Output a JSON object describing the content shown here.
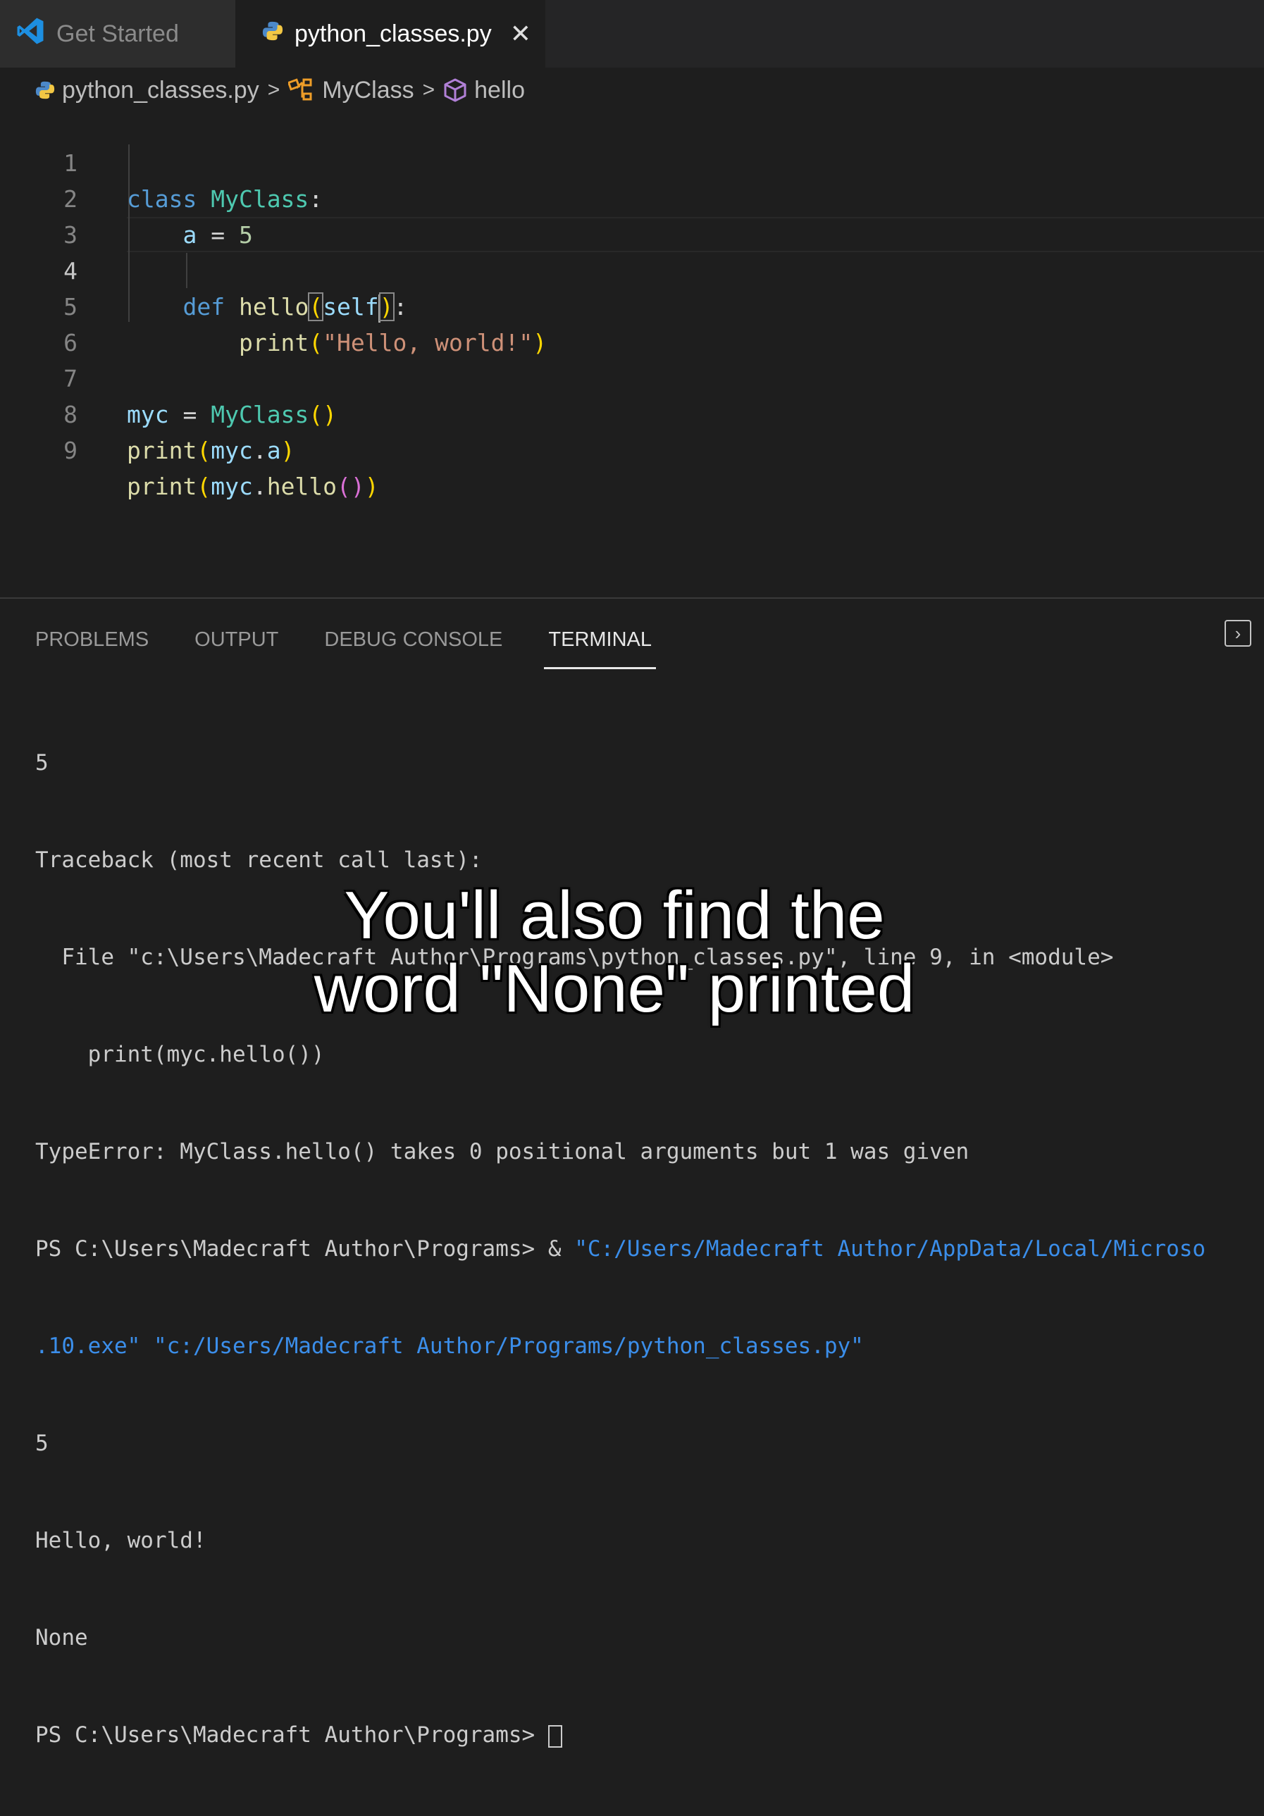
{
  "tabs": [
    {
      "label": "Get Started",
      "icon": "vscode-logo-icon"
    },
    {
      "label": "python_classes.py",
      "icon": "python-file-icon",
      "close": "✕"
    }
  ],
  "breadcrumb": {
    "file": "python_classes.py",
    "class": "MyClass",
    "method": "hello",
    "sep": ">"
  },
  "editor": {
    "line_numbers": [
      "1",
      "2",
      "3",
      "4",
      "5",
      "6",
      "7",
      "8",
      "9"
    ],
    "active_line": 4,
    "code": {
      "l1_kw": "class",
      "l1_cls": "MyClass",
      "l1_colon": ":",
      "l2_var": "a",
      "l2_eq": " = ",
      "l2_num": "5",
      "l4_kw": "def",
      "l4_fn": "hello",
      "l4_open": "(",
      "l4_self": "self",
      "l4_close": ")",
      "l4_colon": ":",
      "l5_fn": "print",
      "l5_open": "(",
      "l5_str": "\"Hello, world!\"",
      "l5_close": ")",
      "l7_var": "myc",
      "l7_eq": " = ",
      "l7_cls": "MyClass",
      "l7_parens": "()",
      "l8_fn": "print",
      "l8_open": "(",
      "l8_var": "myc",
      "l8_dot": ".",
      "l8_attr": "a",
      "l8_close": ")",
      "l9_fn": "print",
      "l9_open": "(",
      "l9_var": "myc",
      "l9_dot": ".",
      "l9_method": "hello",
      "l9_inner": "()",
      "l9_close": ")"
    }
  },
  "panel": {
    "tabs": [
      "PROBLEMS",
      "OUTPUT",
      "DEBUG CONSOLE",
      "TERMINAL"
    ],
    "active_tab": "TERMINAL"
  },
  "terminal": {
    "lines": [
      "5",
      "Traceback (most recent call last):",
      "  File \"c:\\Users\\Madecraft Author\\Programs\\python_classes.py\", line 9, in <module>",
      "    print(myc.hello())",
      "TypeError: MyClass.hello() takes 0 positional arguments but 1 was given"
    ],
    "ps_prompt": "PS C:\\Users\\Madecraft Author\\Programs> & ",
    "ps_exe": "\"C:/Users/Madecraft Author/AppData/Local/Microso",
    "ps_cont": ".10.exe\" \"c:/Users/Madecraft Author/Programs/python_classes.py\"",
    "output_lines": [
      "5",
      "Hello, world!",
      "None"
    ],
    "final_prompt": "PS C:\\Users\\Madecraft Author\\Programs> "
  },
  "subtitle": {
    "line1": "You'll also find the",
    "line2": "word \"None\" printed"
  },
  "colors": {
    "keyword": "#569cd6",
    "class": "#4ec9b0",
    "variable": "#9cdcfe",
    "function": "#dcdcaa",
    "string": "#ce9178",
    "bracket": "#ffd700",
    "bracket_inner": "#da70d6",
    "terminal_path": "#3b8eea"
  }
}
